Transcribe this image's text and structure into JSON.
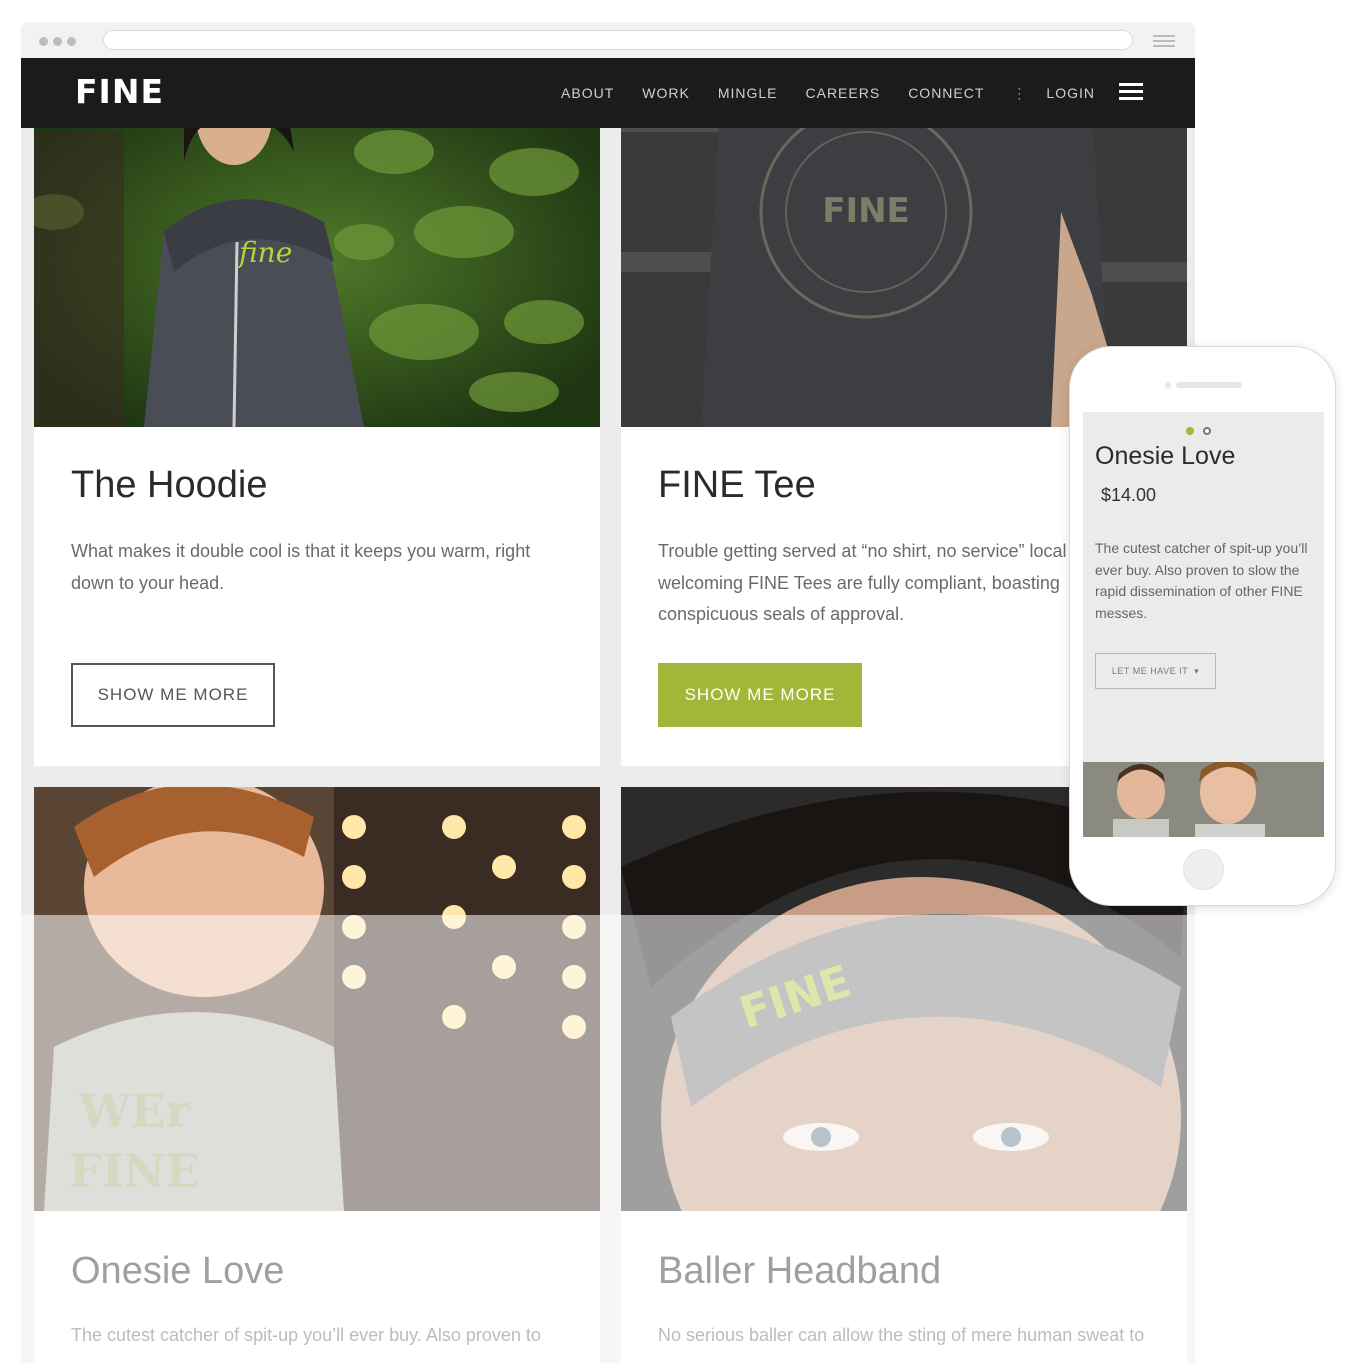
{
  "site": {
    "logo": "FINE",
    "nav": [
      "ABOUT",
      "WORK",
      "MINGLE",
      "CAREERS",
      "CONNECT"
    ],
    "separator": "⋮",
    "login": "LOGIN"
  },
  "cards": [
    {
      "title": "The Hoodie",
      "description": "What makes it double cool is that it keeps you warm, right down to your head.",
      "button": "SHOW ME MORE"
    },
    {
      "title": "FINE Tee",
      "description": "Trouble getting served at “no shirt, no service” local welcoming FINE Tees are fully compliant, boasting conspicuous seals of approval.",
      "button": "SHOW ME MORE"
    },
    {
      "title": "Onesie Love",
      "description": "The cutest catcher of spit-up you’ll ever buy. Also proven to"
    },
    {
      "title": "Baller Headband",
      "description": "No serious baller can allow the sting of mere human sweat to"
    }
  ],
  "mobile": {
    "title": "Onesie Love",
    "price": "$14.00",
    "description": "The cutest catcher of spit-up you’ll ever buy. Also proven to slow the rapid dissemination of other FINE messes.",
    "button": "LET ME HAVE IT",
    "button_icon": "caret-down-icon"
  },
  "colors": {
    "accent": "#a3b637",
    "nav_bg": "#1b1b1b"
  }
}
